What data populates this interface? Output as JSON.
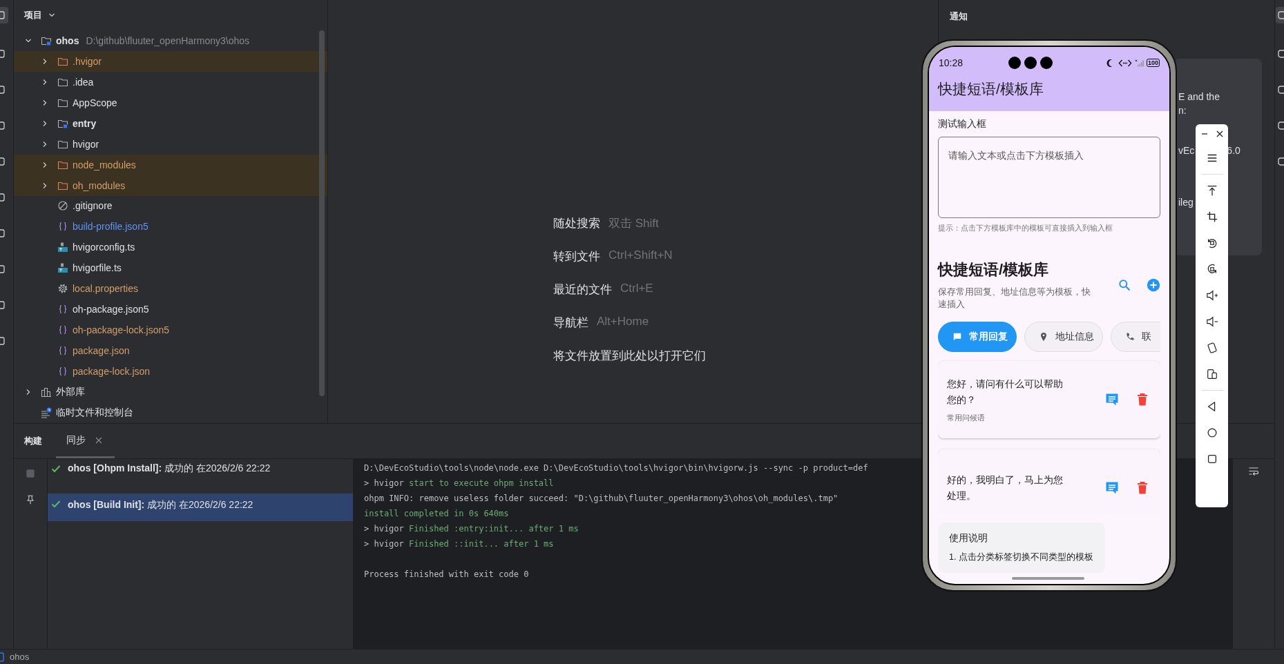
{
  "project_panel": {
    "title": "项目",
    "root": {
      "name": "ohos",
      "path": "D:\\github\\fluuter_openHarmony3\\ohos",
      "kind": "module",
      "expanded": true,
      "excluded": false,
      "ignored": false,
      "modified": false,
      "children": [
        {
          "name": ".hvigor",
          "kind": "folder",
          "expanded": false,
          "excluded": true,
          "ignored": true,
          "modified": false
        },
        {
          "name": ".idea",
          "kind": "folder",
          "expanded": false,
          "excluded": false,
          "ignored": false,
          "modified": false
        },
        {
          "name": "AppScope",
          "kind": "folder",
          "expanded": false,
          "excluded": false,
          "ignored": false,
          "modified": false
        },
        {
          "name": "entry",
          "kind": "module",
          "expanded": false,
          "excluded": false,
          "ignored": false,
          "modified": false
        },
        {
          "name": "hvigor",
          "kind": "folder",
          "expanded": false,
          "excluded": false,
          "ignored": false,
          "modified": false
        },
        {
          "name": "node_modules",
          "kind": "folder",
          "expanded": false,
          "excluded": true,
          "ignored": true,
          "modified": false
        },
        {
          "name": "oh_modules",
          "kind": "folder",
          "expanded": false,
          "excluded": true,
          "ignored": true,
          "modified": false
        },
        {
          "name": ".gitignore",
          "kind": "ignore",
          "excluded": false,
          "ignored": false,
          "modified": false
        },
        {
          "name": "build-profile.json5",
          "kind": "json",
          "excluded": false,
          "ignored": false,
          "modified": true
        },
        {
          "name": "hvigorconfig.ts",
          "kind": "ts",
          "excluded": false,
          "ignored": false,
          "modified": false
        },
        {
          "name": "hvigorfile.ts",
          "kind": "ts",
          "excluded": false,
          "ignored": false,
          "modified": false
        },
        {
          "name": "local.properties",
          "kind": "settings",
          "excluded": false,
          "ignored": true,
          "modified": false
        },
        {
          "name": "oh-package.json5",
          "kind": "json",
          "excluded": false,
          "ignored": false,
          "modified": false
        },
        {
          "name": "oh-package-lock.json5",
          "kind": "json",
          "excluded": false,
          "ignored": true,
          "modified": false
        },
        {
          "name": "package.json",
          "kind": "json",
          "excluded": false,
          "ignored": true,
          "modified": false
        },
        {
          "name": "package-lock.json",
          "kind": "json",
          "excluded": false,
          "ignored": true,
          "modified": false
        }
      ]
    },
    "extra": [
      {
        "name": "外部库",
        "kind": "library",
        "expanded": false
      },
      {
        "name": "临时文件和控制台",
        "kind": "scratch"
      }
    ]
  },
  "editor_hints": [
    {
      "label": "随处搜索",
      "shortcut": "双击 Shift"
    },
    {
      "label": "转到文件",
      "shortcut": "Ctrl+Shift+N"
    },
    {
      "label": "最近的文件",
      "shortcut": "Ctrl+E"
    },
    {
      "label": "导航栏",
      "shortcut": "Alt+Home"
    },
    {
      "label": "将文件放置到此处以打开它们"
    }
  ],
  "notifications": {
    "title": "通知",
    "visible_lines": [
      [
        "E and the"
      ],
      [
        "n:"
      ],
      [
        "vEc",
        "6.0"
      ],
      [
        "ileg"
      ]
    ]
  },
  "build_panel": {
    "title": "构建",
    "tabs": [
      {
        "label": "同步",
        "selected": true
      }
    ],
    "tasks": [
      {
        "text": "**ohos [Ohpm Install]:** 成功的 在2026/2/6 22:22",
        "succeeded": true,
        "selected": false
      },
      {
        "text": "**ohos [Build Init]:** 成功的 在2026/2/6 22:22",
        "succeeded": true,
        "selected": true
      }
    ],
    "console": [
      {
        "kind": "output",
        "segments": [
          {
            "text": "D:\\DevEcoStudio\\tools\\node\\node.exe D:\\DevEcoStudio\\tools\\hvigor\\bin\\hvigorw.js --sync -p product=def",
            "kind": "plain"
          }
        ]
      },
      {
        "kind": "output",
        "segments": [
          {
            "text": "> hvigor ",
            "kind": "plain"
          },
          {
            "text": "start to execute ohpm install",
            "kind": "success"
          }
        ]
      },
      {
        "kind": "output",
        "segments": [
          {
            "text": "ohpm INFO: remove useless folder succeed: \"D:\\github\\fluuter_openHarmony3\\ohos\\oh_modules\\.tmp\"",
            "kind": "plain"
          }
        ]
      },
      {
        "kind": "output",
        "segments": [
          {
            "text": "install completed in 0s 640ms",
            "kind": "success"
          }
        ]
      },
      {
        "kind": "output",
        "segments": [
          {
            "text": "> hvigor ",
            "kind": "plain"
          },
          {
            "text": "Finished :entry:init... after 1 ms",
            "kind": "success"
          }
        ]
      },
      {
        "kind": "output",
        "segments": [
          {
            "text": "> hvigor ",
            "kind": "plain"
          },
          {
            "text": "Finished ::init... after 1 ms",
            "kind": "success"
          }
        ]
      },
      {
        "kind": "blank"
      },
      {
        "kind": "output",
        "segments": [
          {
            "text": "Process finished with exit code 0",
            "kind": "plain"
          }
        ]
      }
    ]
  },
  "status_bar": {
    "project": "ohos"
  },
  "phone": {
    "time": "10:28",
    "battery": "100",
    "app_bar_title": "快捷短语/模板库",
    "input_label": "测试输入框",
    "input": {
      "placeholder": "请输入文本或点击下方模板插入"
    },
    "hint": "提示：点击下方模板库中的模板可直接插入到输入框",
    "heading": "快捷短语/模板库",
    "subtitle": "保存常用回复、地址信息等为模板，快速插入",
    "categories": [
      {
        "label": "常用回复",
        "selected": true
      },
      {
        "label": "地址信息",
        "selected": false
      },
      {
        "label": "联",
        "selected": false
      }
    ],
    "templates": [
      {
        "text": "您好，请问有什么可以帮助您的？",
        "tag": "常用问候语"
      },
      {
        "text": "好的，我明白了，马上为您处理。"
      }
    ],
    "usage": {
      "title": "使用说明",
      "lines": [
        "1. 点击分类标签切换不同类型的模板"
      ]
    }
  }
}
